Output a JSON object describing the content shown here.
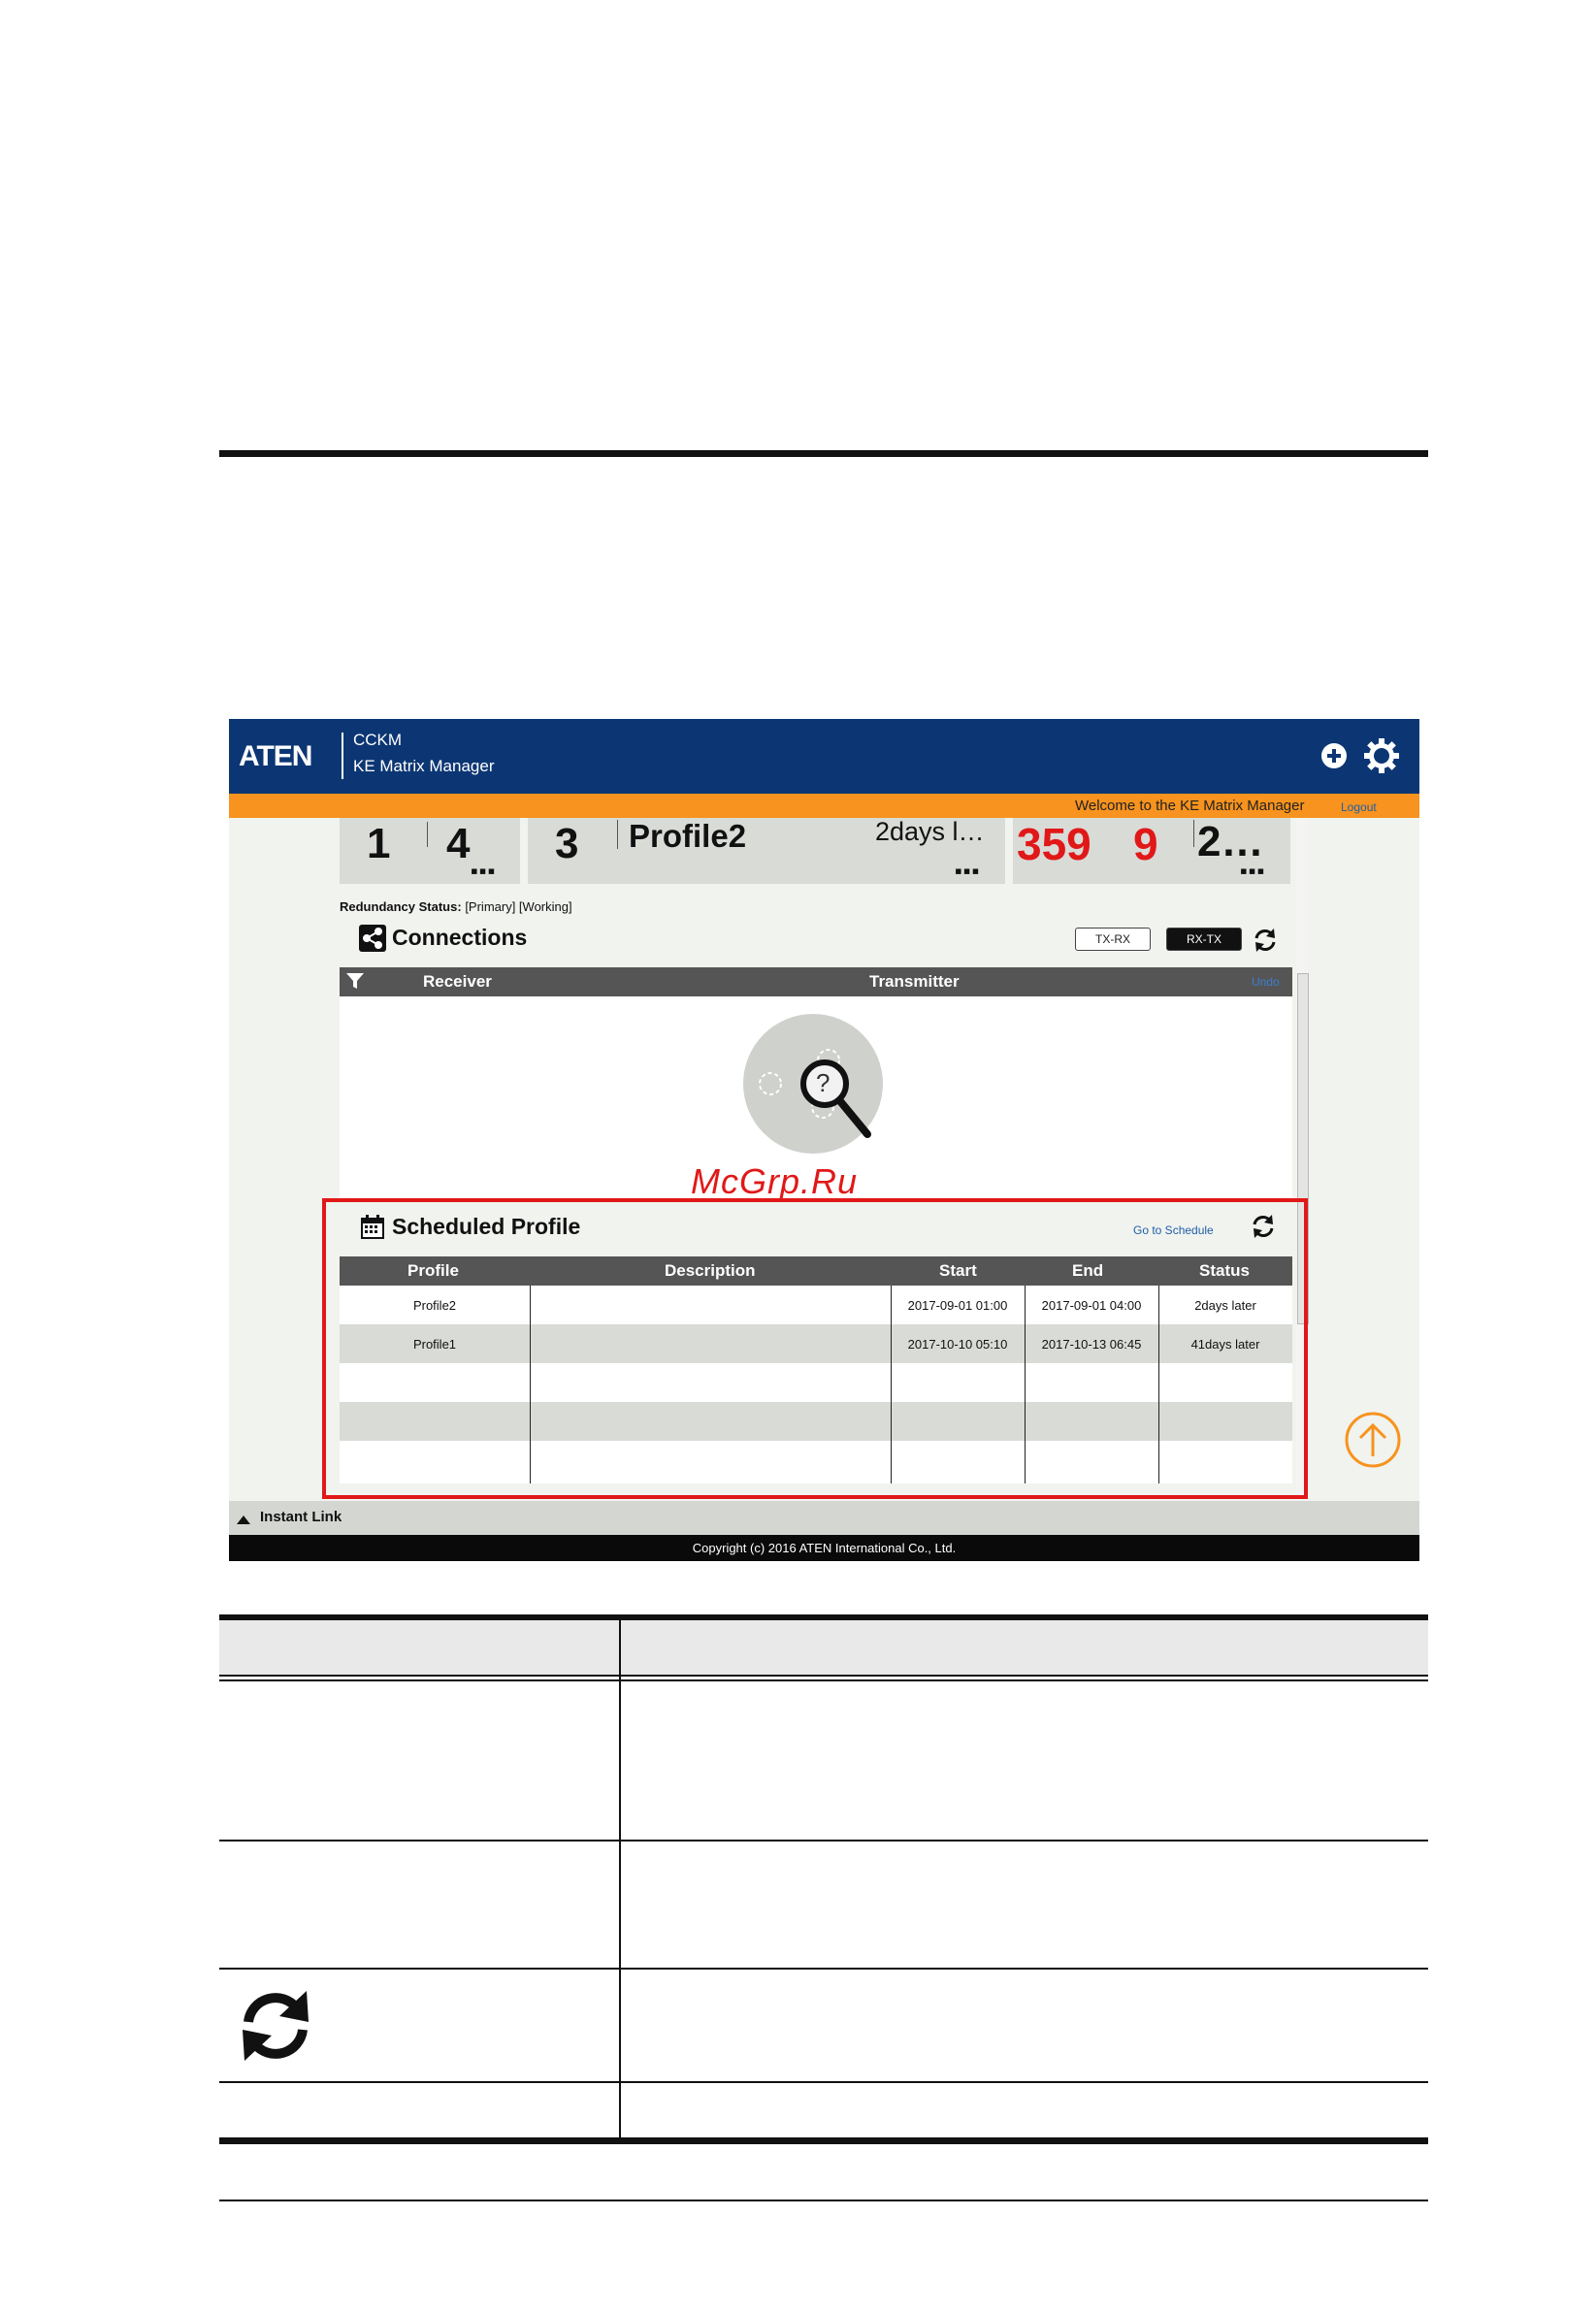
{
  "screenshot": {
    "header": {
      "logo": "ATEN",
      "brand_line1": "CCKM",
      "brand_line2": "KE Matrix Manager",
      "add_icon": "plus-circle-icon",
      "settings_icon": "gear-icon"
    },
    "notice_bar": {
      "welcome": "Welcome to the KE Matrix Manager",
      "logout": "Logout"
    },
    "stats": {
      "panel1": {
        "a": "1",
        "b": "4",
        "more": "▪▪▪"
      },
      "panel2": {
        "a": "3",
        "profile": "Profile2",
        "time": "2days l…",
        "more": "▪▪▪"
      },
      "panel3": {
        "a": "359",
        "b": "9",
        "c": "2…",
        "more": "▪▪▪"
      }
    },
    "redundancy": {
      "label": "Redundancy Status:",
      "value": "[Primary] [Working]"
    },
    "connections": {
      "title": "Connections",
      "btn_txrx": "TX-RX",
      "btn_rxtx": "RX-TX",
      "col_receiver": "Receiver",
      "col_transmitter": "Transmitter",
      "undo": "Undo",
      "empty_glyph": "?"
    },
    "watermark": "McGrp.Ru",
    "scheduled_profile": {
      "title": "Scheduled Profile",
      "go_to_schedule": "Go to Schedule",
      "columns": [
        "Profile",
        "Description",
        "Start",
        "End",
        "Status"
      ],
      "rows": [
        {
          "profile": "Profile2",
          "description": "",
          "start": "2017-09-01 01:00",
          "end": "2017-09-01 04:00",
          "status": "2days later"
        },
        {
          "profile": "Profile1",
          "description": "",
          "start": "2017-10-10 05:10",
          "end": "2017-10-13 06:45",
          "status": "41days later"
        }
      ]
    },
    "instant_link": "Instant Link",
    "copyright": "Copyright (c) 2016 ATEN International Co., Ltd."
  },
  "colors": {
    "header_blue": "#0c3673",
    "accent_orange": "#f7931e",
    "highlight_red": "#e11818",
    "up_button_orange": "#f7931e"
  }
}
